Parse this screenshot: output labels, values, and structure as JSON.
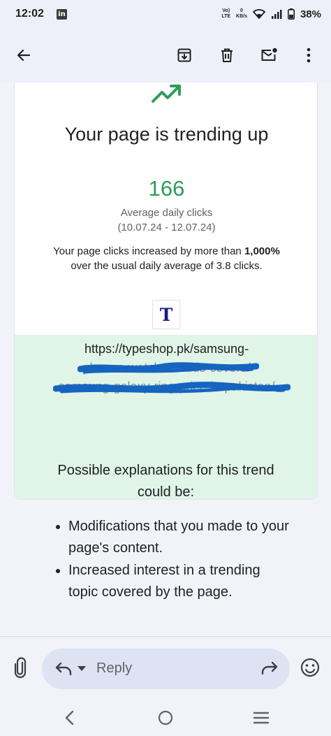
{
  "status_bar": {
    "time": "12:02",
    "app_icon": "linkedin-icon",
    "net_top": "Vo)",
    "net_bottom": "LTE",
    "speed_top": "0",
    "speed_bottom": "KB/s",
    "battery": "38%"
  },
  "toolbar": {
    "back_icon": "arrow-left-icon",
    "archive_icon": "archive-icon",
    "delete_icon": "trash-icon",
    "unread_icon": "mark-unread-icon",
    "more_icon": "more-vertical-icon"
  },
  "email": {
    "headline": "Your page is trending up",
    "clicks_value": "166",
    "clicks_label": "Average daily clicks",
    "date_range": "(10.07.24 - 12.07.24)",
    "increase_prefix": "Your page clicks increased by more than ",
    "increase_bold": "1,000%",
    "increase_suffix": " over the usual daily average of 3.8 clicks.",
    "logo_letter": "T",
    "url_line1": "https://typeshop.pk/samsung-",
    "url_line2": "phones-watches-buds-covers/",
    "url_line3": "samsung-galaxy-ring-price-in-pakistan/",
    "explain_heading": "Possible explanations for this trend could be:",
    "explanations": [
      "Modifications that you made to your page's content.",
      "Increased interest in a trending topic covered by the page."
    ],
    "colors": {
      "accent_green": "#2e9d5b",
      "url_band": "#e0f4e7",
      "redaction_blue": "#1565c0"
    }
  },
  "reply": {
    "label": "Reply",
    "attach_icon": "paperclip-icon",
    "reply_icon": "reply-arrow-icon",
    "dropdown_icon": "caret-down-icon",
    "forward_icon": "forward-arrow-icon",
    "emoji_icon": "emoji-smile-icon"
  },
  "nav": {
    "back": "nav-back-icon",
    "home": "nav-home-icon",
    "recents": "nav-recents-icon"
  }
}
